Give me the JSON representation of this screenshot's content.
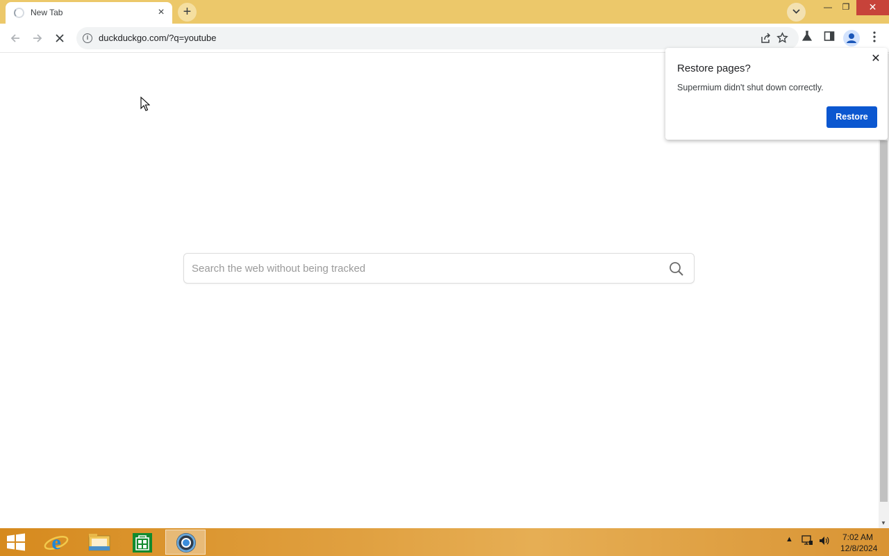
{
  "tab": {
    "title": "New Tab",
    "close_glyph": "×"
  },
  "tabstrip": {
    "new_tab_glyph": "+"
  },
  "window_controls": {
    "minimize": "—",
    "maximize": "❐",
    "close": "✕"
  },
  "toolbar": {
    "url": "duckduckgo.com/?q=youtube",
    "info_glyph": "i"
  },
  "page": {
    "search_placeholder": "Search the web without being tracked"
  },
  "popup": {
    "title": "Restore pages?",
    "message": "Supermium didn't shut down correctly.",
    "restore_label": "Restore",
    "close_glyph": "✕"
  },
  "taskbar": {
    "time": "7:02 AM",
    "date": "12/8/2024",
    "tray_arrow": "▲"
  },
  "colors": {
    "tabstrip": "#ecc86a",
    "accent": "#0b57d0",
    "close_button": "#c7433a"
  },
  "icons": {
    "browser_tabs": [
      "loading-spinner-icon",
      "plus-icon",
      "chevron-down-icon"
    ],
    "toolbar": [
      "back-arrow-icon",
      "forward-arrow-icon",
      "stop-reload-icon",
      "info-icon",
      "share-icon",
      "star-icon",
      "flask-icon",
      "side-panel-icon",
      "profile-icon",
      "kebab-menu-icon"
    ],
    "page": [
      "magnifier-icon"
    ],
    "taskbar": [
      "windows-logo-icon",
      "internet-explorer-icon",
      "file-explorer-icon",
      "store-icon",
      "supermium-icon",
      "network-icon",
      "speaker-icon"
    ]
  }
}
